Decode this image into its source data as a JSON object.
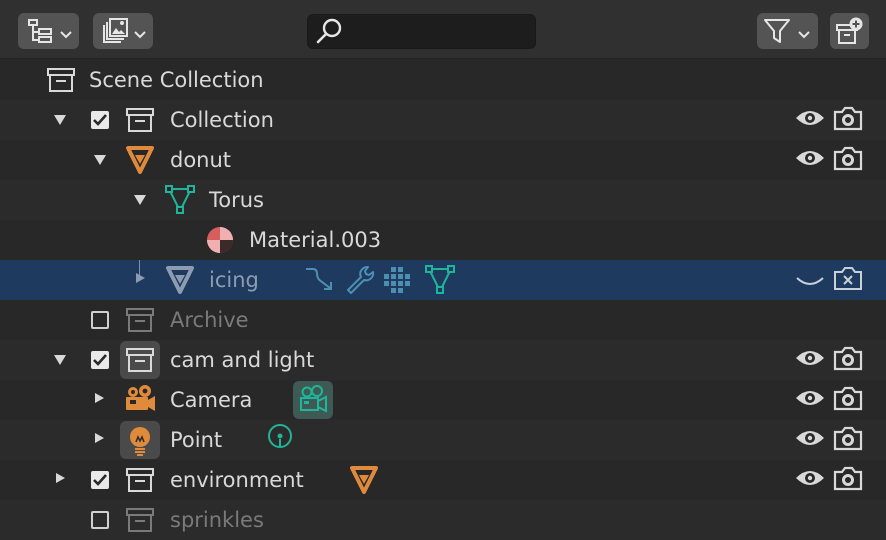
{
  "header": {
    "display_mode_icon": "outliner-icon",
    "filter_icon": "funnel-icon",
    "new_collection_icon": "new-collection-icon",
    "search": {
      "value": "",
      "placeholder": ""
    }
  },
  "rows": [
    {
      "label": "Scene Collection",
      "icon": "collection-icon"
    },
    {
      "label": "Collection",
      "icon": "collection-icon",
      "expanded": true,
      "checked": true,
      "visible": true,
      "renderable": true
    },
    {
      "label": "donut",
      "icon": "mesh-object-icon",
      "expanded": true,
      "visible": true,
      "renderable": true
    },
    {
      "label": "Torus",
      "icon": "mesh-data-icon",
      "expanded": true
    },
    {
      "label": "Material.003",
      "icon": "material-icon"
    },
    {
      "label": "icing",
      "icon": "mesh-object-icon",
      "selected": true,
      "visible": false,
      "renderable": false,
      "extra_icons": [
        "modifier-arrow-icon",
        "wrench-icon",
        "grid-icon",
        "mesh-data-icon"
      ]
    },
    {
      "label": "Archive",
      "icon": "collection-icon",
      "checked": false
    },
    {
      "label": "cam and light",
      "icon": "collection-icon",
      "expanded": true,
      "checked": true,
      "visible": true,
      "renderable": true
    },
    {
      "label": "Camera",
      "icon": "camera-icon",
      "visible": true,
      "renderable": true,
      "extra_icons": [
        "camera-data-icon"
      ]
    },
    {
      "label": "Point",
      "icon": "light-icon",
      "visible": true,
      "renderable": true,
      "extra_icons": [
        "light-data-icon"
      ]
    },
    {
      "label": "environment",
      "icon": "collection-icon",
      "expanded": false,
      "checked": true,
      "visible": true,
      "renderable": true,
      "extra_icons": [
        "mesh-object-icon"
      ]
    },
    {
      "label": "sprinkles",
      "icon": "collection-icon",
      "checked": false
    }
  ],
  "colors": {
    "background": "#282828",
    "row_alt": "#2b2b2b",
    "selected_row": "#1f3a5f",
    "object_orange": "#e08a3c",
    "data_teal": "#1fb59a",
    "material_red": "#d65e5e",
    "icon_light": "#d9d9d9"
  }
}
